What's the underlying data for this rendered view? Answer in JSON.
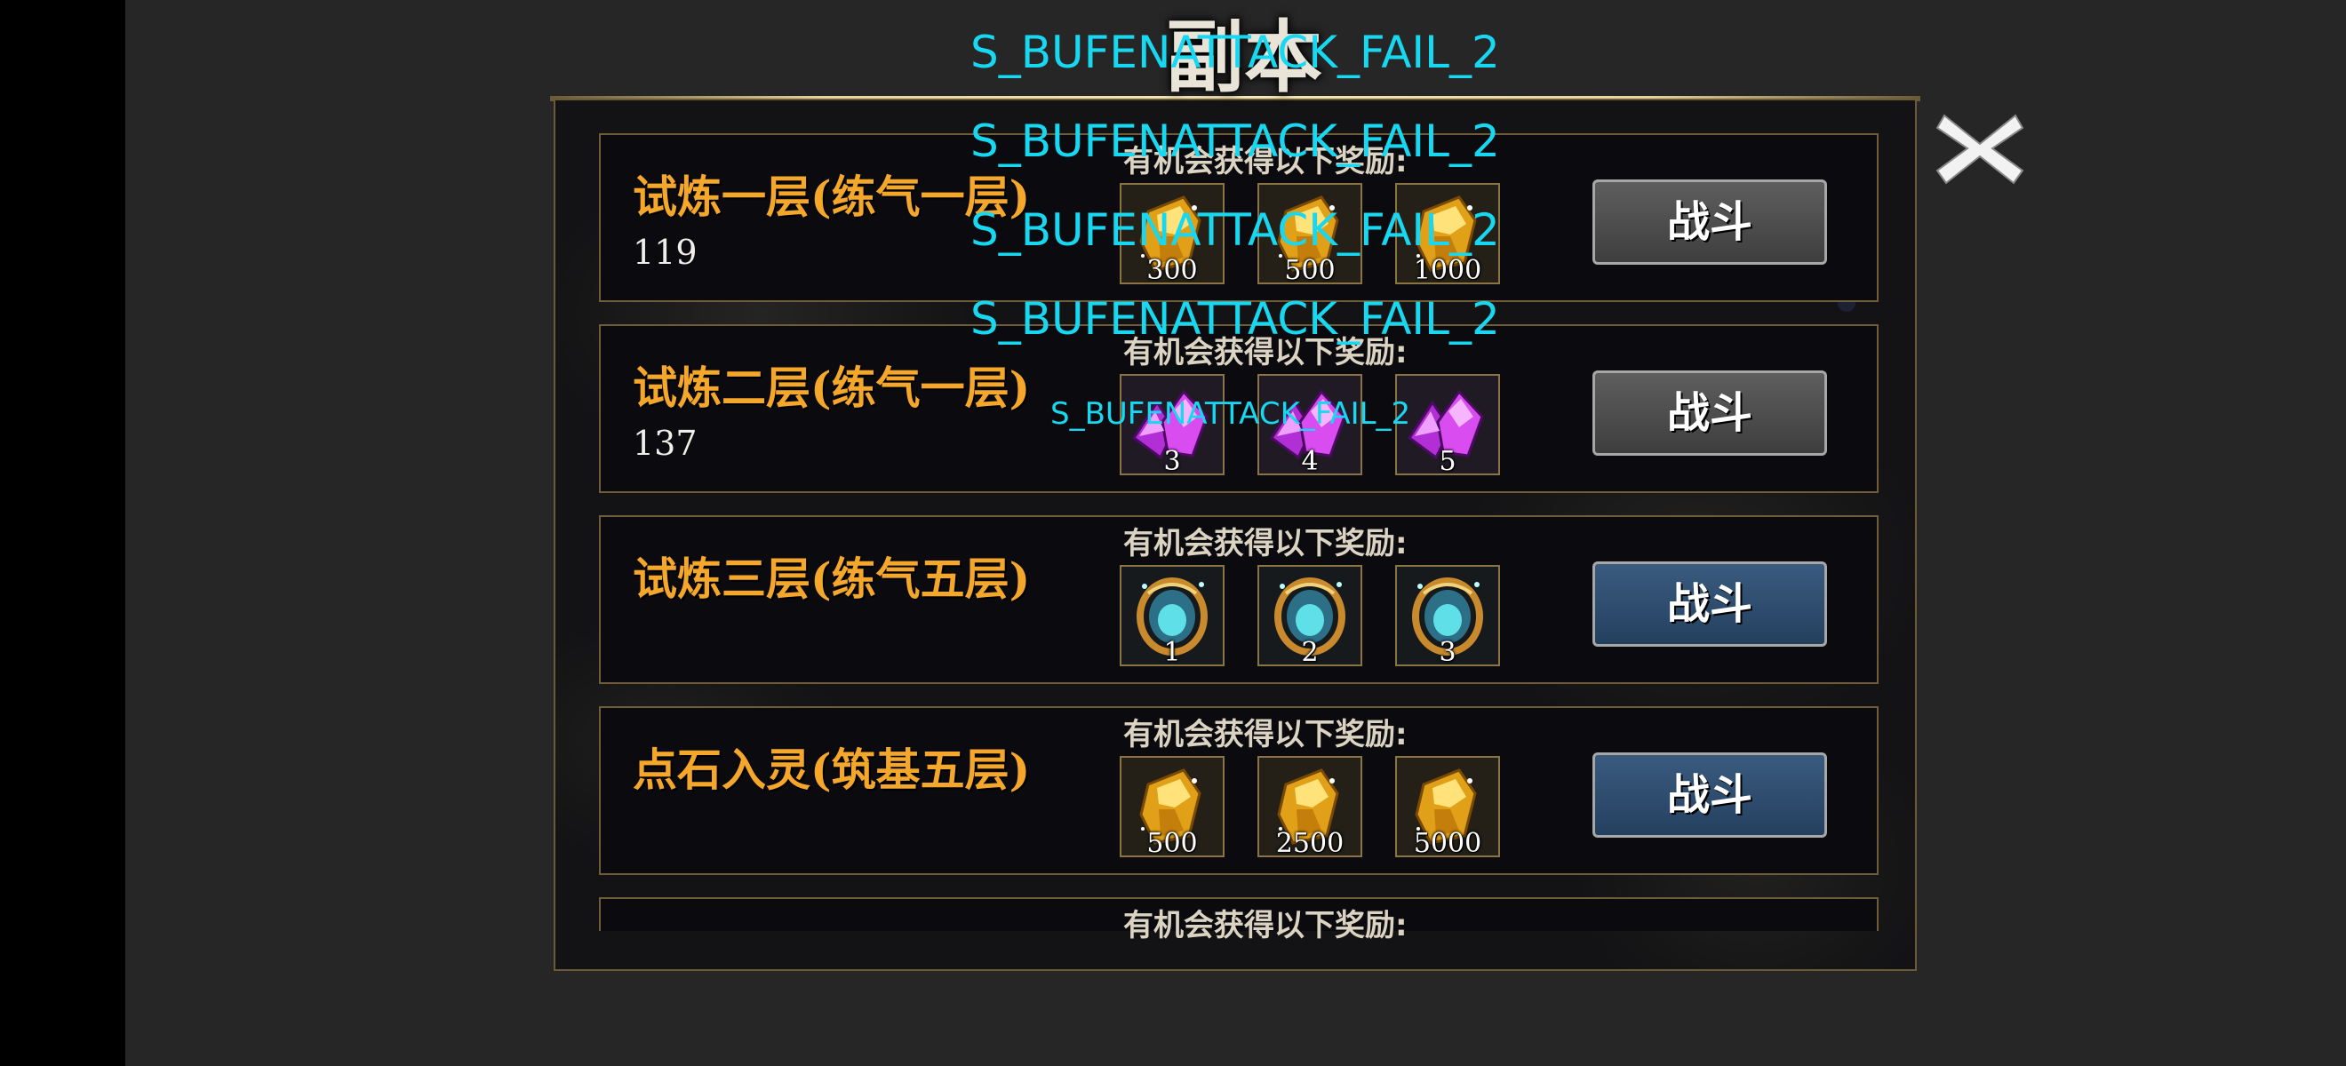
{
  "dialog": {
    "title": "副本",
    "close_icon": "close-x-icon"
  },
  "reward_label": "有机会获得以下奖励:",
  "colors": {
    "title_orange": "#f4a72b",
    "button_gray": "#4a4a4a",
    "button_blue": "#2e4c6e",
    "debug_cyan": "#17d8f0",
    "frame_gold": "#6e5d38"
  },
  "stages": [
    {
      "title": "试炼一层(练气一层)",
      "sub": "119",
      "reward_type": "gold-crystal-icon",
      "rewards": [
        "300",
        "500",
        "1000"
      ],
      "button": "战斗",
      "button_style": "gray"
    },
    {
      "title": "试炼二层(练气一层)",
      "sub": "137",
      "reward_type": "purple-crystal-icon",
      "rewards": [
        "3",
        "4",
        "5"
      ],
      "button": "战斗",
      "button_style": "gray"
    },
    {
      "title": "试炼三层(练气五层)",
      "sub": "",
      "reward_type": "jade-ring-icon",
      "rewards": [
        "1",
        "2",
        "3"
      ],
      "button": "战斗",
      "button_style": "blue"
    },
    {
      "title": "点石入灵(筑基五层)",
      "sub": "",
      "reward_type": "gold-crystal-icon",
      "rewards": [
        "500",
        "2500",
        "5000"
      ],
      "button": "战斗",
      "button_style": "blue"
    },
    {
      "title": "",
      "sub": "",
      "reward_type": "",
      "rewards": [],
      "button": "",
      "button_style": ""
    }
  ],
  "debug_messages": [
    "S_BUFENATTACK_FAIL_2",
    "S_BUFENATTACK_FAIL_2",
    "S_BUFENATTACK_FAIL_2",
    "S_BUFENATTACK_FAIL_2",
    "S_BUFENATTACK_FAIL_2"
  ]
}
